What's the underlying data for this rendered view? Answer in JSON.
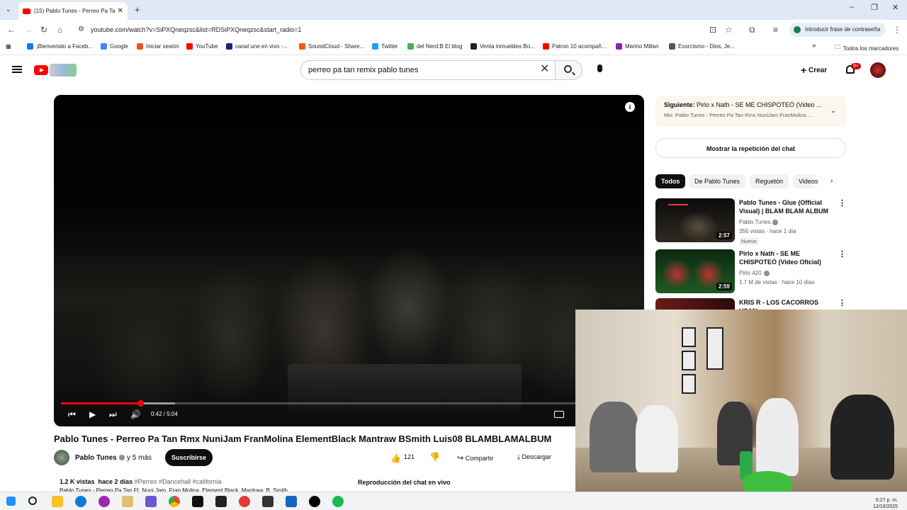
{
  "browser": {
    "tab_title": "(15) Pablo Tunes - Perreo Pa Ta",
    "url": "youtube.com/watch?v=SiPXQneqzsc&list=RDSiPXQneqzsc&start_radio=1",
    "password_prompt": "Introducir frase de contraseña",
    "all_bookmarks": "Todos los marcadores",
    "bookmarks": [
      {
        "label": "¡Bienvenido a Faceb...",
        "color": "#1877f2"
      },
      {
        "label": "Google",
        "color": "#4285f4"
      },
      {
        "label": "Iniciar sesión",
        "color": "#f25022"
      },
      {
        "label": "YouTube",
        "color": "#ff0000"
      },
      {
        "label": "canal une en vivo -...",
        "color": "#1a237e"
      },
      {
        "label": "SoundCloud - Share...",
        "color": "#ff5500"
      },
      {
        "label": "Twitter",
        "color": "#1da1f2"
      },
      {
        "label": "del Nerd:B El blog",
        "color": "#4caf50"
      },
      {
        "label": "Venta inmuebles Bo...",
        "color": "#222222"
      },
      {
        "label": "Patron 10 acompañ...",
        "color": "#ff0000"
      },
      {
        "label": "Marino Millan",
        "color": "#8e24aa"
      },
      {
        "label": "Exorcismo - Dios, Je...",
        "color": "#555555"
      }
    ]
  },
  "header": {
    "search_value": "perreo pa tan remix pablo tunes",
    "create_label": "Crear",
    "notifications_badge": "9+"
  },
  "player": {
    "time_current": "0:42",
    "time_total": "5:04",
    "time_label": "0:42 / 5:04",
    "progress_fraction": 0.138
  },
  "video": {
    "title": "Pablo Tunes - Perreo Pa Tan Rmx NuniJam FranMolina ElementBlack Mantraw BSmith Luis08 BLAMBLAMALBUM",
    "channel": "Pablo Tunes",
    "collaborators": "y 5 más",
    "subscribe_label": "Suscribirse",
    "likes": "121",
    "share_label": "Compartir",
    "download_label": "Descargar",
    "views": "1.2 K vistas",
    "age": "hace 2 días",
    "tags": "#Perreo #Dancehall #california",
    "desc_line2": "Pablo Tunes - Perreo Pa Tan Ft. Nuni Jam, Fran Molina, Element Black, Mantraw, B. Smith",
    "live_chat_replay": "Reproducción del chat en vivo"
  },
  "sidebar": {
    "next_prefix": "Siguiente:",
    "next_title": "Pirlo x Nath - SE ME CHISPOTEÓ (Video ...",
    "next_mix": "Mix: Pablo Tunes - Perreo Pa Tan Rmx NuniJam FranMolina ...",
    "chat_replay_button": "Mostrar la repetición del chat",
    "chips": [
      "Todos",
      "De Pablo Tunes",
      "Reguetón",
      "Videos"
    ],
    "recommendations": [
      {
        "title": "Pablo Tunes - Glue (Official Visual) | BLAM BLAM ALBUM",
        "channel": "Pablo Tunes",
        "meta": "356 vistas · hace 1 día",
        "tag": "Nuevo",
        "duration": "2:57"
      },
      {
        "title": "Pirlo x Nath - SE ME CHISPOTEÓ (Video Oficial)",
        "channel": "Pirlo 420",
        "meta": "1.7 M de vistas · hace 10 días",
        "duration": "2:59"
      },
      {
        "title": "KRIS R - LOS CACORROS USAN",
        "channel": "",
        "meta": "",
        "duration": ""
      }
    ]
  },
  "taskbar": {
    "time": "6:27 p. m.",
    "date": "12/10/2025"
  }
}
